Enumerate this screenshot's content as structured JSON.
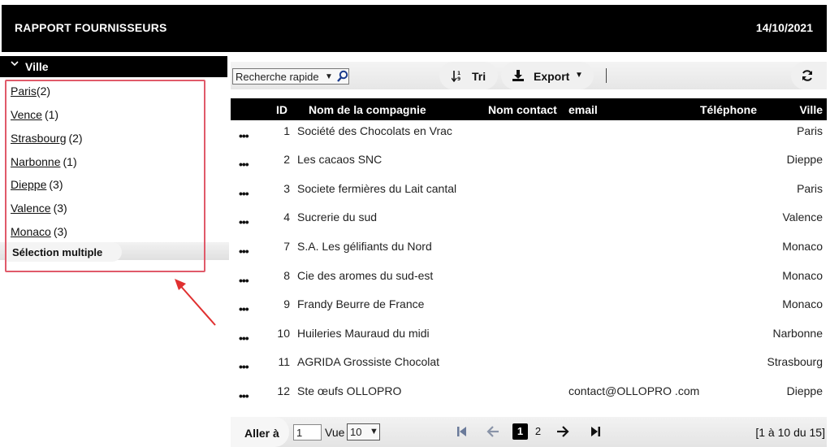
{
  "header": {
    "title": "RAPPORT FOURNISSEURS",
    "date": "14/10/2021"
  },
  "facet": {
    "title": "Ville",
    "items": [
      {
        "label": "Paris",
        "count": "(2)"
      },
      {
        "label": "Vence",
        "count": "(1)"
      },
      {
        "label": "Strasbourg",
        "count": "(2)"
      },
      {
        "label": "Narbonne",
        "count": "(1)"
      },
      {
        "label": "Dieppe",
        "count": "(3)"
      },
      {
        "label": "Valence",
        "count": "(3)"
      },
      {
        "label": "Monaco",
        "count": "(3)"
      }
    ],
    "multi_select_label": "Sélection multiple"
  },
  "toolbar": {
    "search_value": "Recherche rapide",
    "sort_label": "Tri",
    "export_label": "Export"
  },
  "table": {
    "columns": {
      "id": "ID",
      "company": "Nom de la compagnie",
      "contact": "Nom contact",
      "email": "email",
      "phone": "Téléphone",
      "city": "Ville"
    },
    "row_menu_label": "•••",
    "rows": [
      {
        "id": "1",
        "company": "Société des Chocolats en Vrac",
        "email": "",
        "city": "Paris"
      },
      {
        "id": "2",
        "company": "Les cacaos SNC",
        "email": "",
        "city": "Dieppe"
      },
      {
        "id": "3",
        "company": "Societe fermières du Lait cantal",
        "email": "",
        "city": "Paris"
      },
      {
        "id": "4",
        "company": "Sucrerie du sud",
        "email": "",
        "city": "Valence"
      },
      {
        "id": "7",
        "company": "S.A. Les gélifiants du Nord",
        "email": "",
        "city": "Monaco"
      },
      {
        "id": "8",
        "company": "Cie des aromes du sud-est",
        "email": "",
        "city": "Monaco"
      },
      {
        "id": "9",
        "company": "Frandy Beurre de France",
        "email": "",
        "city": "Monaco"
      },
      {
        "id": "10",
        "company": "Huileries Mauraud du midi",
        "email": "",
        "city": "Narbonne"
      },
      {
        "id": "11",
        "company": "AGRIDA Grossiste Chocolat",
        "email": "",
        "city": "Strasbourg"
      },
      {
        "id": "12",
        "company": "Ste œufs OLLOPRO",
        "email": "contact@OLLOPRO .com",
        "city": "Dieppe"
      }
    ]
  },
  "pagination": {
    "goto_label": "Aller à",
    "goto_value": "1",
    "view_label": "Vue",
    "view_value": "10",
    "current_page": "1",
    "next_page": "2",
    "range_text": "[1 à 10 du 15]"
  },
  "colors": {
    "header_bg": "#000000",
    "highlight": "#e05a6a",
    "arrow": "#e03030"
  }
}
